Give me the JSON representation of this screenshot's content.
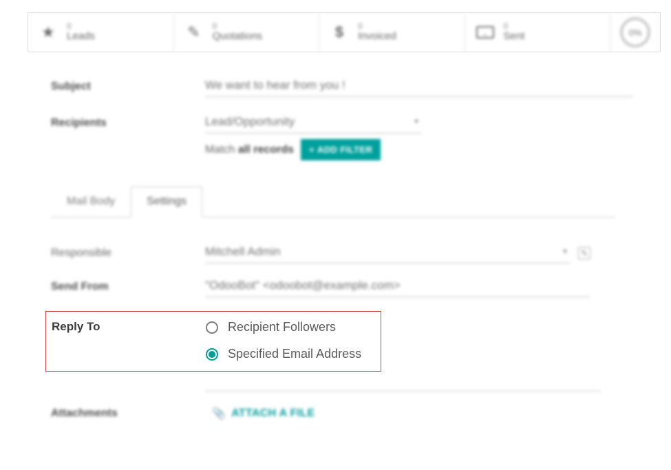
{
  "stats": {
    "leads": {
      "count": "0",
      "label": "Leads"
    },
    "quotations": {
      "count": "0",
      "label": "Quotations"
    },
    "invoiced": {
      "count": "0",
      "label": "Invoiced"
    },
    "sent": {
      "count": "0",
      "label": "Sent"
    },
    "percent": "0%"
  },
  "form": {
    "subject_label": "Subject",
    "subject_value": "We want to hear from you !",
    "recipients_label": "Recipients",
    "recipients_value": "Lead/Opportunity",
    "match_prefix": "Match ",
    "match_bold": "all records",
    "add_filter_label": "ADD FILTER"
  },
  "tabs": {
    "mail_body": "Mail Body",
    "settings": "Settings"
  },
  "settings": {
    "responsible_label": "Responsible",
    "responsible_value": "Mitchell Admin",
    "send_from_label": "Send From",
    "send_from_value": "\"OdooBot\" <odoobot@example.com>",
    "reply_to_label": "Reply To",
    "reply_opt_followers": "Recipient Followers",
    "reply_opt_specified": "Specified Email Address",
    "attachments_label": "Attachments",
    "attach_file_label": "ATTACH A FILE"
  }
}
